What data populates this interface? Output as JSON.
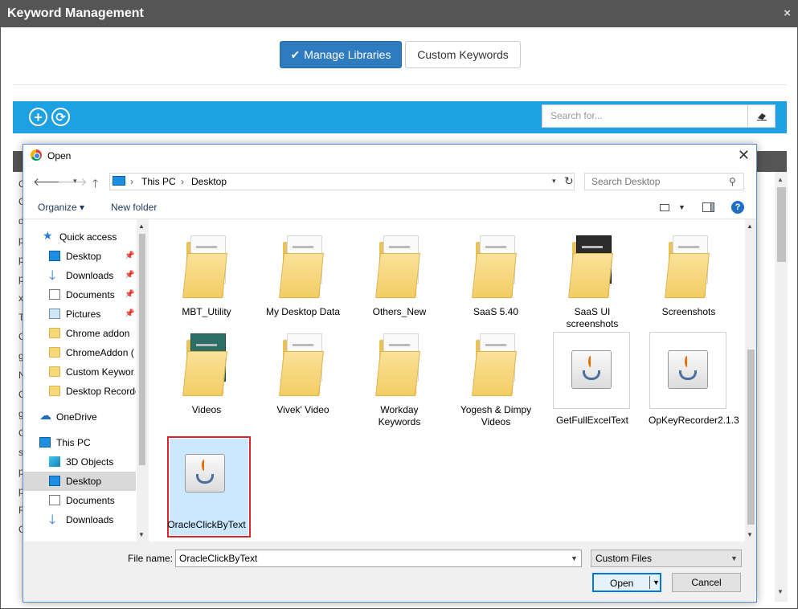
{
  "window": {
    "title": "Keyword Management",
    "close_glyph": "×"
  },
  "tabs": {
    "manage_label": "Manage Libraries",
    "custom_label": "Custom Keywords"
  },
  "toolbar": {
    "search_placeholder": "Search for..."
  },
  "background_rows": [
    "C",
    "C",
    "d",
    "p",
    "p",
    "p",
    "x",
    "T",
    "C",
    "g",
    "N",
    "C",
    "g",
    "C",
    "s",
    "p",
    "p",
    "R",
    "C"
  ],
  "dialog": {
    "title": "Open",
    "breadcrumb": [
      "This PC",
      "Desktop"
    ],
    "search_placeholder": "Search Desktop",
    "organize_label": "Organize ▾",
    "new_folder_label": "New folder",
    "help_glyph": "?",
    "nav_items": [
      {
        "label": "Quick access",
        "icon": "star-icon"
      },
      {
        "label": "Desktop",
        "icon": "desktop-icon",
        "pinned": true
      },
      {
        "label": "Downloads",
        "icon": "download-icon",
        "pinned": true
      },
      {
        "label": "Documents",
        "icon": "document-icon",
        "pinned": true
      },
      {
        "label": "Pictures",
        "icon": "pictures-icon",
        "pinned": true
      },
      {
        "label": "Chrome addon",
        "icon": "folder-icon"
      },
      {
        "label": "ChromeAddon (",
        "icon": "folder-icon"
      },
      {
        "label": "Custom Keywor",
        "icon": "folder-icon"
      },
      {
        "label": "Desktop Recorde",
        "icon": "folder-icon"
      },
      {
        "label": "OneDrive",
        "icon": "cloud-icon"
      },
      {
        "label": "This PC",
        "icon": "pc-icon"
      },
      {
        "label": "3D Objects",
        "icon": "cube-icon"
      },
      {
        "label": "Desktop",
        "icon": "desktop-icon",
        "selected": true
      },
      {
        "label": "Documents",
        "icon": "document-icon"
      },
      {
        "label": "Downloads",
        "icon": "download-icon"
      }
    ],
    "files": [
      {
        "name": "MBT_Utility",
        "type": "folder"
      },
      {
        "name": "My Desktop Data",
        "type": "folder"
      },
      {
        "name": "Others_New",
        "type": "folder"
      },
      {
        "name": "SaaS 5.40",
        "type": "folder"
      },
      {
        "name": "SaaS UI screenshots",
        "type": "folder"
      },
      {
        "name": "Screenshots",
        "type": "folder"
      },
      {
        "name": "Videos",
        "type": "folder"
      },
      {
        "name": "Vivek' Video",
        "type": "folder"
      },
      {
        "name": "Workday Keywords",
        "type": "folder"
      },
      {
        "name": "Yogesh & Dimpy Videos",
        "type": "folder"
      },
      {
        "name": "GetFullExcelText",
        "type": "java"
      },
      {
        "name": "OpKeyRecorder2.1.3",
        "type": "java"
      },
      {
        "name": "OracleClickByText",
        "type": "java",
        "selected": true
      }
    ],
    "file_name_label": "File name:",
    "file_name_value": "OracleClickByText",
    "file_type": "Custom Files",
    "open_label": "Open",
    "cancel_label": "Cancel"
  }
}
